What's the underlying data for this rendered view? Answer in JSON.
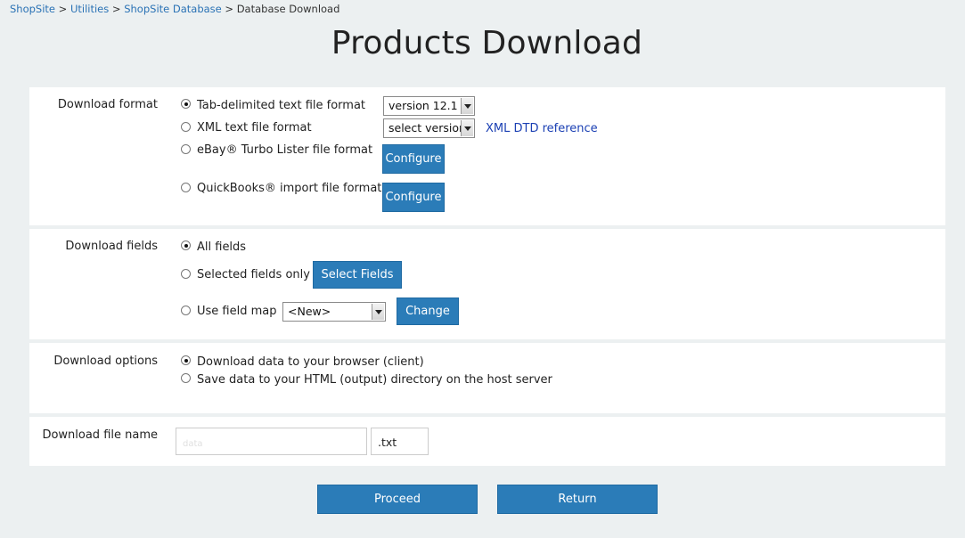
{
  "breadcrumb": {
    "items": [
      "ShopSite",
      "Utilities",
      "ShopSite Database"
    ],
    "separator": ">",
    "current": "Database Download"
  },
  "title": "Products Download",
  "format": {
    "label": "Download format",
    "options": [
      "Tab-delimited text file format",
      "XML text file format",
      "eBay® Turbo Lister file format",
      "QuickBooks® import file format"
    ],
    "selected_index": 0,
    "tab_version": "version 12.1",
    "xml_version": "select version",
    "xml_dtd_link": "XML DTD reference",
    "configure_label": "Configure"
  },
  "fields": {
    "label": "Download fields",
    "options": [
      "All fields",
      "Selected fields only",
      "Use field map"
    ],
    "selected_index": 0,
    "select_fields_label": "Select Fields",
    "field_map_value": "<New>",
    "change_label": "Change"
  },
  "options": {
    "label": "Download options",
    "choices": [
      "Download data to your browser (client)",
      "Save data to your HTML (output) directory on the host server"
    ],
    "selected_index": 0
  },
  "filename": {
    "label": "Download file name",
    "value": "",
    "placeholder": "data",
    "extension": ".txt"
  },
  "actions": {
    "proceed": "Proceed",
    "return": "Return"
  }
}
